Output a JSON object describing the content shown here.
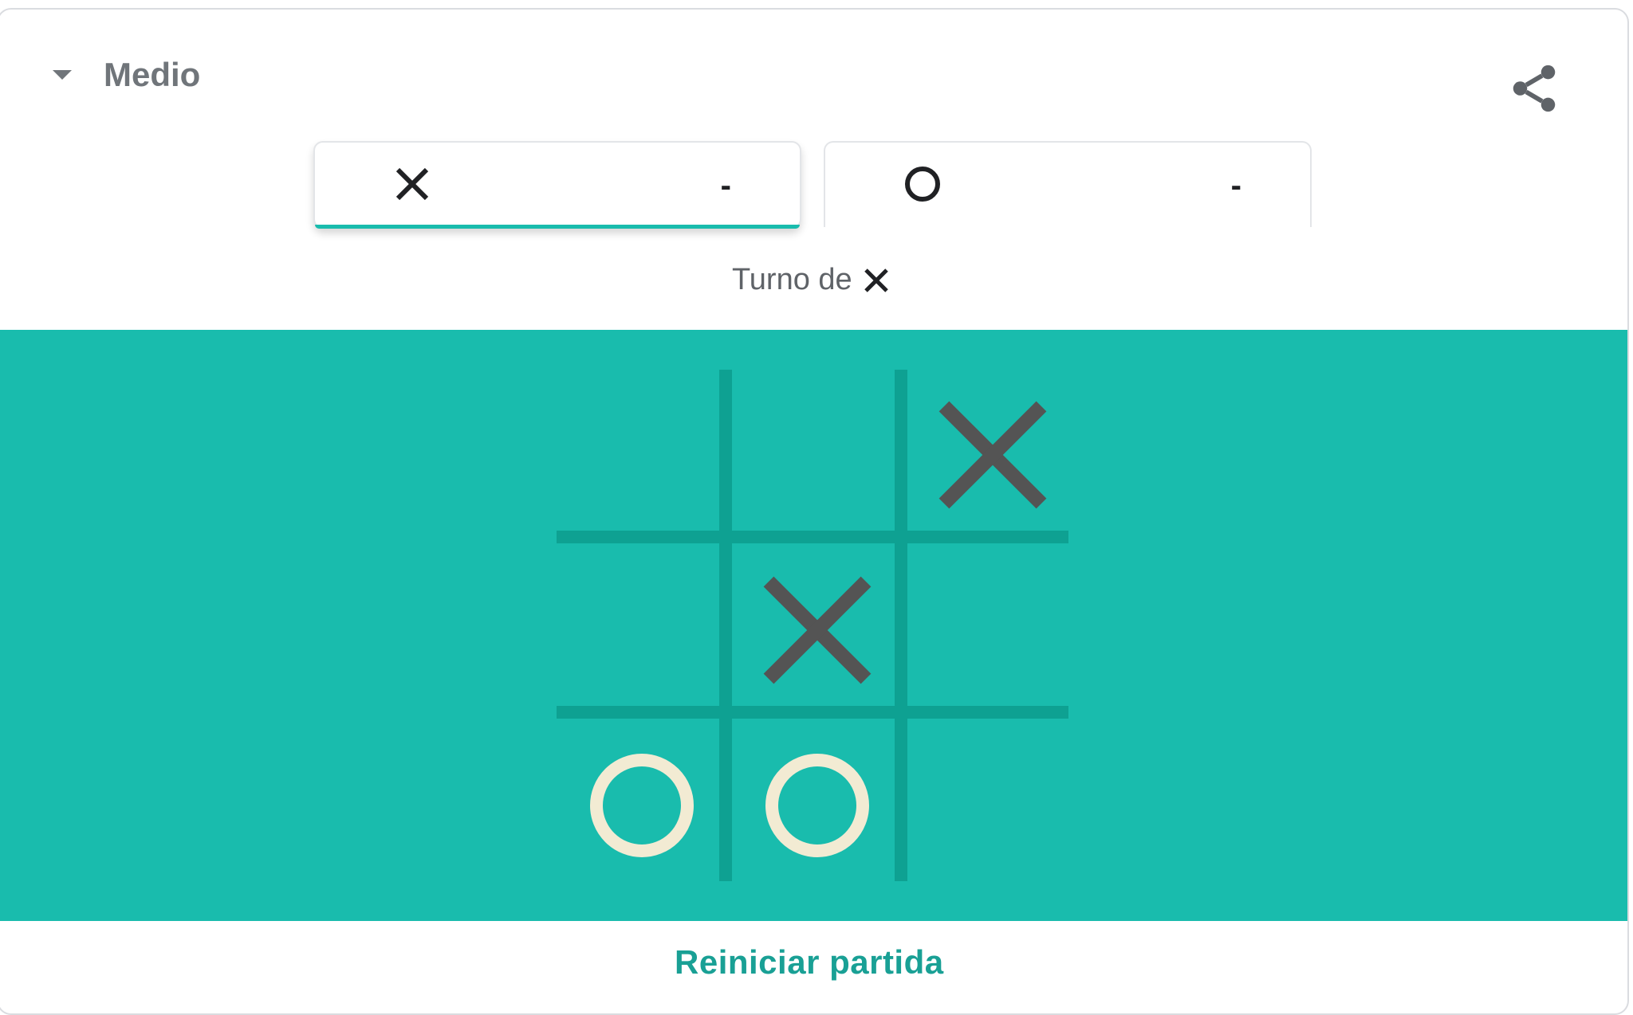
{
  "header": {
    "difficulty": "Medio"
  },
  "scores": {
    "x": {
      "symbol": "X",
      "value": "-",
      "active": true
    },
    "o": {
      "symbol": "O",
      "value": "-",
      "active": false
    }
  },
  "turn": {
    "label": "Turno de",
    "symbol": "X"
  },
  "board": {
    "cells": [
      [
        "",
        "",
        "X"
      ],
      [
        "",
        "X",
        ""
      ],
      [
        "O",
        "O",
        ""
      ]
    ]
  },
  "colors": {
    "board_bg": "#19bcad",
    "grid": "#0ea192",
    "x_mark": "#545454",
    "o_mark": "#f2ebd3",
    "accent": "#19a095"
  },
  "icons": {
    "difficulty": "caret-down-icon",
    "share": "share-icon"
  },
  "footer": {
    "restart_label": "Reiniciar partida"
  }
}
